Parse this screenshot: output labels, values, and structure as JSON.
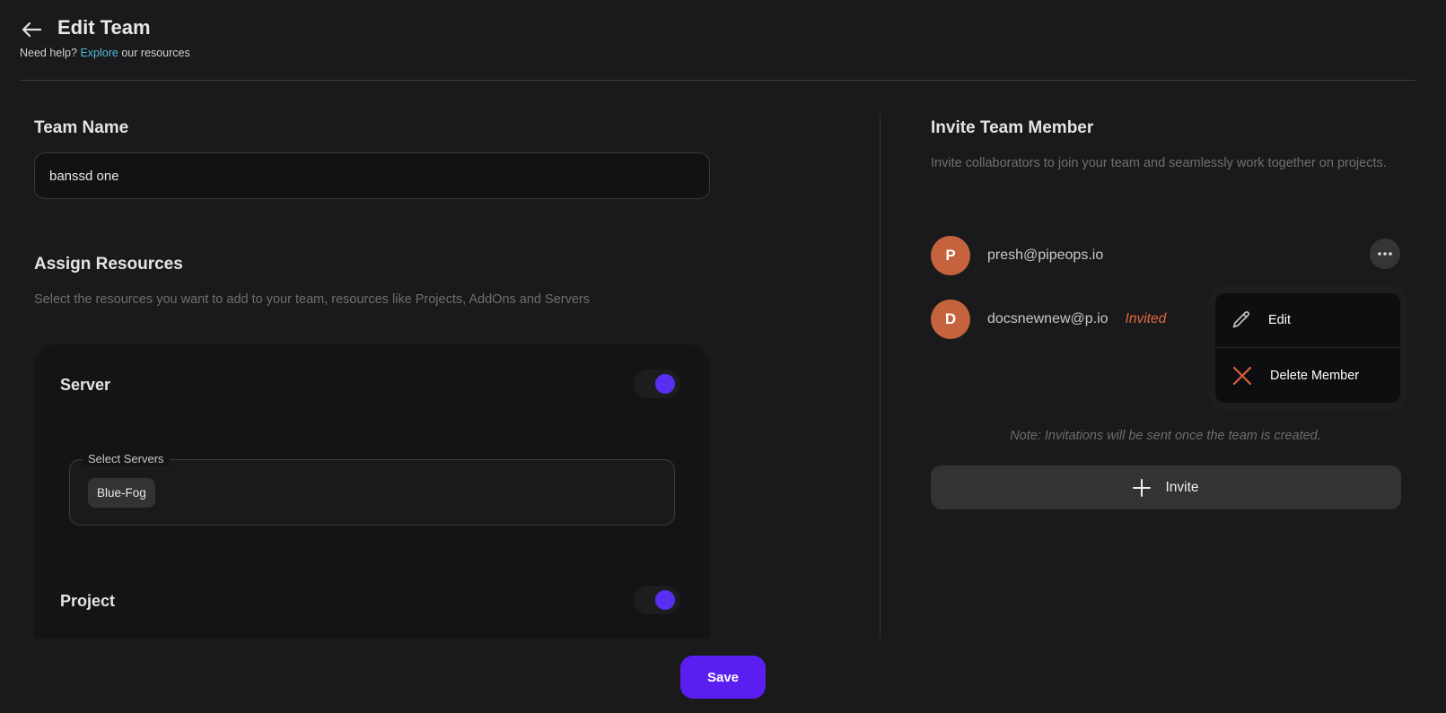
{
  "header": {
    "title": "Edit Team",
    "help_prefix": "Need help?",
    "help_link": "Explore",
    "help_suffix": "our resources"
  },
  "team_name": {
    "label": "Team Name",
    "value": "banssd one"
  },
  "assign_resources": {
    "title": "Assign Resources",
    "description": "Select the resources you want to add to your team, resources like Projects, AddOns and Servers",
    "server": {
      "label": "Server",
      "enabled": true,
      "select_label": "Select Servers",
      "selected": [
        "Blue-Fog"
      ]
    },
    "project": {
      "label": "Project",
      "enabled": true
    }
  },
  "invite": {
    "title": "Invite Team Member",
    "description": "Invite collaborators to join your team and seamlessly work together on projects.",
    "members": [
      {
        "initial": "P",
        "email": "presh@pipeops.io",
        "status": ""
      },
      {
        "initial": "D",
        "email": "docsnewnew@p.io",
        "status": "Invited"
      }
    ],
    "menu": {
      "edit_label": "Edit",
      "delete_label": "Delete Member"
    },
    "note": "Note: Invitations will be sent once the team is created.",
    "invite_label": "Invite"
  },
  "save_label": "Save",
  "colors": {
    "accent": "#5a1ff0",
    "avatar": "#c4633d",
    "invited": "#e2693c",
    "link": "#4fb8d8"
  }
}
